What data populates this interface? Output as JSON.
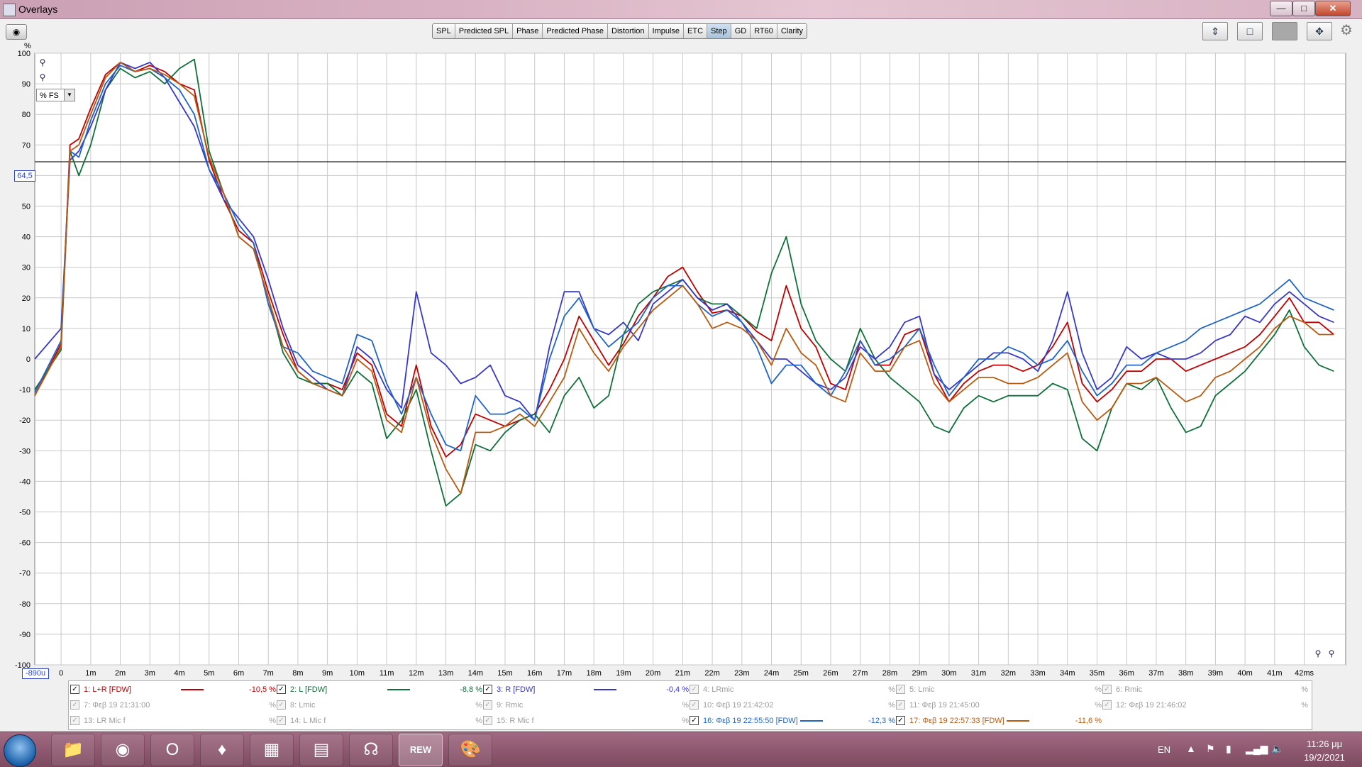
{
  "window": {
    "title": "Overlays",
    "min_glyph": "—",
    "max_glyph": "□",
    "close_glyph": "✕"
  },
  "tabs": [
    {
      "label": "SPL",
      "active": false
    },
    {
      "label": "Predicted SPL",
      "active": false
    },
    {
      "label": "Phase",
      "active": false
    },
    {
      "label": "Predicted Phase",
      "active": false
    },
    {
      "label": "Distortion",
      "active": false
    },
    {
      "label": "Impulse",
      "active": false
    },
    {
      "label": "ETC",
      "active": false
    },
    {
      "label": "Step",
      "active": true
    },
    {
      "label": "GD",
      "active": false
    },
    {
      "label": "RT60",
      "active": false
    },
    {
      "label": "Clarity",
      "active": false
    }
  ],
  "toolbar_icons": [
    "vertical-scale-icon",
    "window-layout-icon",
    "grey-panel-icon",
    "fit-arrows-icon",
    "gear-icon"
  ],
  "plot": {
    "y_unit": "%",
    "unit_select": "% FS",
    "cursor_value": "64,5",
    "x_start": "-890u",
    "y_ticks": [
      "100",
      "90",
      "80",
      "70",
      "60",
      "50",
      "40",
      "30",
      "20",
      "10",
      "0",
      "-10",
      "-20",
      "-30",
      "-40",
      "-50",
      "-60",
      "-70",
      "-80",
      "-90",
      "-100"
    ],
    "x_ticks": [
      "0",
      "1m",
      "2m",
      "3m",
      "4m",
      "5m",
      "6m",
      "7m",
      "8m",
      "9m",
      "10m",
      "11m",
      "12m",
      "13m",
      "14m",
      "15m",
      "16m",
      "17m",
      "18m",
      "19m",
      "20m",
      "21m",
      "22m",
      "23m",
      "24m",
      "25m",
      "26m",
      "27m",
      "28m",
      "29m",
      "30m",
      "31m",
      "32m",
      "33m",
      "34m",
      "35m",
      "36m",
      "37m",
      "38m",
      "39m",
      "40m",
      "41m",
      "42ms"
    ]
  },
  "chart_data": {
    "type": "line",
    "xlabel": "",
    "ylabel": "%",
    "xlim": [
      -0.89,
      43.4
    ],
    "ylim": [
      -100,
      100
    ],
    "grid": true,
    "cursor_y": 64.5,
    "series": [
      {
        "name": "1: L+R [FDW]",
        "color": "#c00000",
        "x": [
          -0.89,
          0,
          0.3,
          0.6,
          1,
          1.5,
          2,
          2.5,
          3,
          3.5,
          4,
          4.5,
          5,
          5.5,
          6,
          6.5,
          7,
          7.5,
          8,
          8.5,
          9,
          9.5,
          10,
          10.5,
          11,
          11.5,
          12,
          12.5,
          13,
          13.5,
          14,
          14.5,
          15,
          15.5,
          16,
          16.5,
          17,
          17.5,
          18,
          18.5,
          19,
          19.5,
          20,
          20.5,
          21,
          21.5,
          22,
          22.5,
          23,
          23.5,
          24,
          24.5,
          25,
          25.5,
          26,
          26.5,
          27,
          27.5,
          28,
          28.5,
          29,
          29.5,
          30,
          30.5,
          31,
          31.5,
          32,
          32.5,
          33,
          33.5,
          34,
          34.5,
          35,
          35.5,
          36,
          36.5,
          37,
          37.5,
          38,
          38.5,
          39,
          39.5,
          40,
          40.5,
          41,
          41.5,
          42,
          42.5,
          43
        ],
        "y": [
          -12,
          5,
          70,
          72,
          82,
          93,
          97,
          94,
          96,
          94,
          90,
          88,
          65,
          52,
          42,
          38,
          22,
          8,
          -4,
          -8,
          -8,
          -10,
          2,
          -2,
          -18,
          -22,
          -2,
          -22,
          -32,
          -28,
          -18,
          -20,
          -22,
          -20,
          -18,
          -10,
          0,
          14,
          6,
          -2,
          5,
          14,
          20,
          27,
          30,
          22,
          15,
          16,
          14,
          9,
          6,
          24,
          10,
          4,
          -8,
          -10,
          6,
          -2,
          -2,
          8,
          10,
          -5,
          -14,
          -8,
          -4,
          -2,
          -2,
          -4,
          -2,
          4,
          12,
          -8,
          -14,
          -10,
          -4,
          -4,
          0,
          0,
          -4,
          -2,
          0,
          2,
          4,
          8,
          14,
          20,
          12,
          12,
          8
        ]
      },
      {
        "name": "2: L [FDW]",
        "color": "#10703a",
        "x": [
          -0.89,
          0,
          0.3,
          0.6,
          1,
          1.5,
          2,
          2.5,
          3,
          3.5,
          4,
          4.5,
          5,
          5.5,
          6,
          6.5,
          7,
          7.5,
          8,
          8.5,
          9,
          9.5,
          10,
          10.5,
          11,
          11.5,
          12,
          12.5,
          13,
          13.5,
          14,
          14.5,
          15,
          15.5,
          16,
          16.5,
          17,
          17.5,
          18,
          18.5,
          19,
          19.5,
          20,
          20.5,
          21,
          21.5,
          22,
          22.5,
          23,
          23.5,
          24,
          24.5,
          25,
          25.5,
          26,
          26.5,
          27,
          27.5,
          28,
          28.5,
          29,
          29.5,
          30,
          30.5,
          31,
          31.5,
          32,
          32.5,
          33,
          33.5,
          34,
          34.5,
          35,
          35.5,
          36,
          36.5,
          37,
          37.5,
          38,
          38.5,
          39,
          39.5,
          40,
          40.5,
          41,
          41.5,
          42,
          42.5,
          43
        ],
        "y": [
          -10,
          3,
          68,
          60,
          70,
          88,
          95,
          92,
          94,
          90,
          95,
          98,
          68,
          54,
          40,
          36,
          20,
          2,
          -6,
          -8,
          -8,
          -12,
          -4,
          -8,
          -26,
          -20,
          -10,
          -30,
          -48,
          -44,
          -28,
          -30,
          -24,
          -20,
          -18,
          -24,
          -12,
          -6,
          -16,
          -12,
          8,
          18,
          22,
          24,
          26,
          20,
          18,
          18,
          14,
          10,
          28,
          40,
          18,
          6,
          0,
          -4,
          10,
          0,
          -6,
          -10,
          -14,
          -22,
          -24,
          -16,
          -12,
          -14,
          -12,
          -12,
          -12,
          -8,
          -10,
          -26,
          -30,
          -16,
          -8,
          -10,
          -6,
          -16,
          -24,
          -22,
          -12,
          -8,
          -4,
          2,
          8,
          16,
          4,
          -2,
          -4
        ]
      },
      {
        "name": "3: R [FDW]",
        "color": "#3838c8",
        "x": [
          -0.89,
          0,
          0.3,
          0.6,
          1,
          1.5,
          2,
          2.5,
          3,
          3.5,
          4,
          4.5,
          5,
          5.5,
          6,
          6.5,
          7,
          7.5,
          8,
          8.5,
          9,
          9.5,
          10,
          10.5,
          11,
          11.5,
          12,
          12.5,
          13,
          13.5,
          14,
          14.5,
          15,
          15.5,
          16,
          16.5,
          17,
          17.5,
          18,
          18.5,
          19,
          19.5,
          20,
          20.5,
          21,
          21.5,
          22,
          22.5,
          23,
          23.5,
          24,
          24.5,
          25,
          25.5,
          26,
          26.5,
          27,
          27.5,
          28,
          28.5,
          29,
          29.5,
          30,
          30.5,
          31,
          31.5,
          32,
          32.5,
          33,
          33.5,
          34,
          34.5,
          35,
          35.5,
          36,
          36.5,
          37,
          37.5,
          38,
          38.5,
          39,
          39.5,
          40,
          40.5,
          41,
          41.5,
          42,
          42.5,
          43
        ],
        "y": [
          0,
          10,
          65,
          68,
          76,
          88,
          97,
          95,
          97,
          92,
          84,
          76,
          62,
          52,
          46,
          40,
          26,
          10,
          -2,
          -6,
          -10,
          -12,
          4,
          0,
          -10,
          -16,
          22,
          2,
          -2,
          -8,
          -6,
          -2,
          -12,
          -14,
          -20,
          4,
          22,
          22,
          10,
          8,
          12,
          6,
          18,
          22,
          26,
          20,
          16,
          18,
          12,
          6,
          0,
          0,
          -4,
          -8,
          -10,
          -6,
          4,
          0,
          4,
          12,
          14,
          -5,
          -10,
          -6,
          -2,
          2,
          2,
          0,
          -4,
          6,
          22,
          2,
          -10,
          -6,
          4,
          0,
          2,
          0,
          0,
          2,
          6,
          8,
          14,
          12,
          18,
          22,
          18,
          14,
          12
        ]
      },
      {
        "name": "16: Φεβ 19 22:55:50 [FDW]",
        "color": "#1f64c8",
        "x": [
          -0.89,
          0,
          0.3,
          0.6,
          1,
          1.5,
          2,
          2.5,
          3,
          3.5,
          4,
          4.5,
          5,
          5.5,
          6,
          6.5,
          7,
          7.5,
          8,
          8.5,
          9,
          9.5,
          10,
          10.5,
          11,
          11.5,
          12,
          12.5,
          13,
          13.5,
          14,
          14.5,
          15,
          15.5,
          16,
          16.5,
          17,
          17.5,
          18,
          18.5,
          19,
          19.5,
          20,
          20.5,
          21,
          21.5,
          22,
          22.5,
          23,
          23.5,
          24,
          24.5,
          25,
          25.5,
          26,
          26.5,
          27,
          27.5,
          28,
          28.5,
          29,
          29.5,
          30,
          30.5,
          31,
          31.5,
          32,
          32.5,
          33,
          33.5,
          34,
          34.5,
          35,
          35.5,
          36,
          36.5,
          37,
          37.5,
          38,
          38.5,
          39,
          39.5,
          40,
          40.5,
          41,
          41.5,
          42,
          42.5,
          43
        ],
        "y": [
          -11,
          6,
          68,
          66,
          78,
          90,
          96,
          94,
          95,
          92,
          88,
          80,
          62,
          54,
          44,
          38,
          18,
          4,
          2,
          -4,
          -6,
          -8,
          8,
          6,
          -8,
          -18,
          -6,
          -18,
          -28,
          -30,
          -12,
          -18,
          -18,
          -16,
          -20,
          0,
          14,
          20,
          10,
          4,
          8,
          12,
          20,
          24,
          24,
          18,
          14,
          16,
          12,
          4,
          -8,
          -2,
          -2,
          -8,
          -12,
          -4,
          6,
          -2,
          0,
          4,
          10,
          -2,
          -12,
          -6,
          0,
          0,
          4,
          2,
          -2,
          0,
          6,
          -4,
          -12,
          -8,
          -2,
          -2,
          2,
          4,
          6,
          10,
          12,
          14,
          16,
          18,
          22,
          26,
          20,
          18,
          16
        ]
      },
      {
        "name": "17: Φεβ 19 22:57:33 [FDW]",
        "color": "#b85a10",
        "x": [
          -0.89,
          0,
          0.3,
          0.6,
          1,
          1.5,
          2,
          2.5,
          3,
          3.5,
          4,
          4.5,
          5,
          5.5,
          6,
          6.5,
          7,
          7.5,
          8,
          8.5,
          9,
          9.5,
          10,
          10.5,
          11,
          11.5,
          12,
          12.5,
          13,
          13.5,
          14,
          14.5,
          15,
          15.5,
          16,
          16.5,
          17,
          17.5,
          18,
          18.5,
          19,
          19.5,
          20,
          20.5,
          21,
          21.5,
          22,
          22.5,
          23,
          23.5,
          24,
          24.5,
          25,
          25.5,
          26,
          26.5,
          27,
          27.5,
          28,
          28.5,
          29,
          29.5,
          30,
          30.5,
          31,
          31.5,
          32,
          32.5,
          33,
          33.5,
          34,
          34.5,
          35,
          35.5,
          36,
          36.5,
          37,
          37.5,
          38,
          38.5,
          39,
          39.5,
          40,
          40.5,
          41,
          41.5,
          42,
          42.5,
          43
        ],
        "y": [
          -12,
          4,
          68,
          70,
          80,
          92,
          97,
          94,
          95,
          93,
          90,
          86,
          66,
          54,
          40,
          36,
          20,
          4,
          -4,
          -8,
          -10,
          -12,
          0,
          -4,
          -20,
          -24,
          -6,
          -24,
          -36,
          -44,
          -24,
          -24,
          -22,
          -18,
          -22,
          -14,
          -6,
          10,
          2,
          -4,
          4,
          10,
          16,
          20,
          24,
          18,
          10,
          12,
          10,
          6,
          -2,
          10,
          2,
          -2,
          -12,
          -14,
          2,
          -4,
          -4,
          4,
          6,
          -8,
          -14,
          -10,
          -6,
          -6,
          -8,
          -8,
          -6,
          -2,
          2,
          -14,
          -20,
          -16,
          -8,
          -8,
          -6,
          -10,
          -14,
          -12,
          -6,
          -4,
          0,
          4,
          10,
          14,
          12,
          8,
          8
        ]
      }
    ]
  },
  "legend": [
    {
      "label": "1: L+R [FDW]",
      "value": "-10,5 %",
      "checked": true,
      "color": "#c00000"
    },
    {
      "label": "2: L [FDW]",
      "value": "-8,8 %",
      "checked": true,
      "color": "#10703a"
    },
    {
      "label": "3: R [FDW]",
      "value": "-0,4 %",
      "checked": true,
      "color": "#3838c8"
    },
    {
      "label": "4: LRmic",
      "value": "%",
      "checked": false
    },
    {
      "label": "5: Lmic",
      "value": "%",
      "checked": false
    },
    {
      "label": "6: Rmic",
      "value": "%",
      "checked": false
    },
    {
      "label": "7: Φεβ 19 21:31:00",
      "value": "%",
      "checked": false
    },
    {
      "label": "8: Lmic",
      "value": "%",
      "checked": false
    },
    {
      "label": "9: Rmic",
      "value": "%",
      "checked": false
    },
    {
      "label": "10: Φεβ 19 21:42:02",
      "value": "%",
      "checked": false
    },
    {
      "label": "11: Φεβ 19 21:45:00",
      "value": "%",
      "checked": false
    },
    {
      "label": "12: Φεβ 19 21:46:02",
      "value": "%",
      "checked": false
    },
    {
      "label": "13: LR Mic f",
      "value": "%",
      "checked": false
    },
    {
      "label": "14: L Mic f",
      "value": "%",
      "checked": false
    },
    {
      "label": "15: R Mic f",
      "value": "%",
      "checked": false
    },
    {
      "label": "16: Φεβ 19 22:55:50 [FDW]",
      "value": "-12,3 %",
      "checked": true,
      "color": "#1f64c8"
    },
    {
      "label": "17: Φεβ 19 22:57:33 [FDW]",
      "value": "-11,6 %",
      "checked": true,
      "color": "#b85a10"
    }
  ],
  "taskbar": {
    "apps": [
      {
        "name": "file-explorer-icon",
        "glyph": "📁"
      },
      {
        "name": "chrome-icon",
        "glyph": "◉"
      },
      {
        "name": "opera-icon",
        "glyph": "O"
      },
      {
        "name": "brave-icon",
        "glyph": "♦"
      },
      {
        "name": "grid-app-icon",
        "glyph": "▦"
      },
      {
        "name": "winrar-icon",
        "glyph": "▤"
      },
      {
        "name": "headphones-icon",
        "glyph": "☊"
      },
      {
        "name": "rew-icon",
        "glyph": "REW"
      },
      {
        "name": "paint-icon",
        "glyph": "🎨"
      }
    ],
    "active_app": 7,
    "lang": "EN",
    "time": "11:26 μμ",
    "date": "19/2/2021"
  }
}
